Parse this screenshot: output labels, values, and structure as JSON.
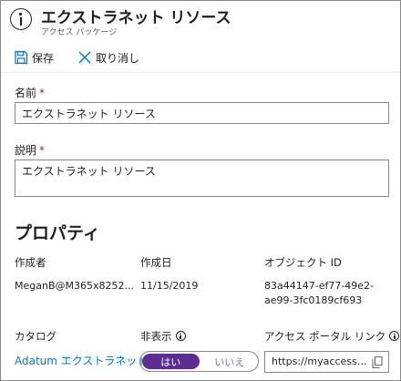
{
  "header": {
    "title": "エクストラネット リソース",
    "subtitle": "アクセス パッケージ",
    "icon": "info-icon"
  },
  "toolbar": {
    "save_label": "保存",
    "cancel_label": "取り消し"
  },
  "form": {
    "name_label": "名前",
    "name_value": "エクストラネット リソース",
    "description_label": "説明",
    "description_value": "エクストラネット リソース",
    "required_mark": "*"
  },
  "properties": {
    "section_title": "プロパティ",
    "creator_label": "作成者",
    "creator_value": "MeganB@M365x8252...",
    "created_date_label": "作成日",
    "created_date_value": "11/15/2019",
    "object_id_label": "オブジェクト ID",
    "object_id_line1": "83a44147-ef77-49e2-",
    "object_id_line2": "ae99-3fc0189cf693",
    "catalog_label": "カタログ",
    "catalog_value": "Adatum エクストラネット",
    "hidden_label": "非表示",
    "hidden_yes": "はい",
    "hidden_no": "いいえ",
    "hidden_selected": "はい",
    "portal_link_label": "アクセス ポータル リンク",
    "portal_link_value": "https://myaccess.microsoft.com"
  },
  "colors": {
    "accent_blue": "#0078d4",
    "toggle_purple": "#5c2e91",
    "required_red": "#a4262c",
    "border_gray": "#8a8886"
  }
}
